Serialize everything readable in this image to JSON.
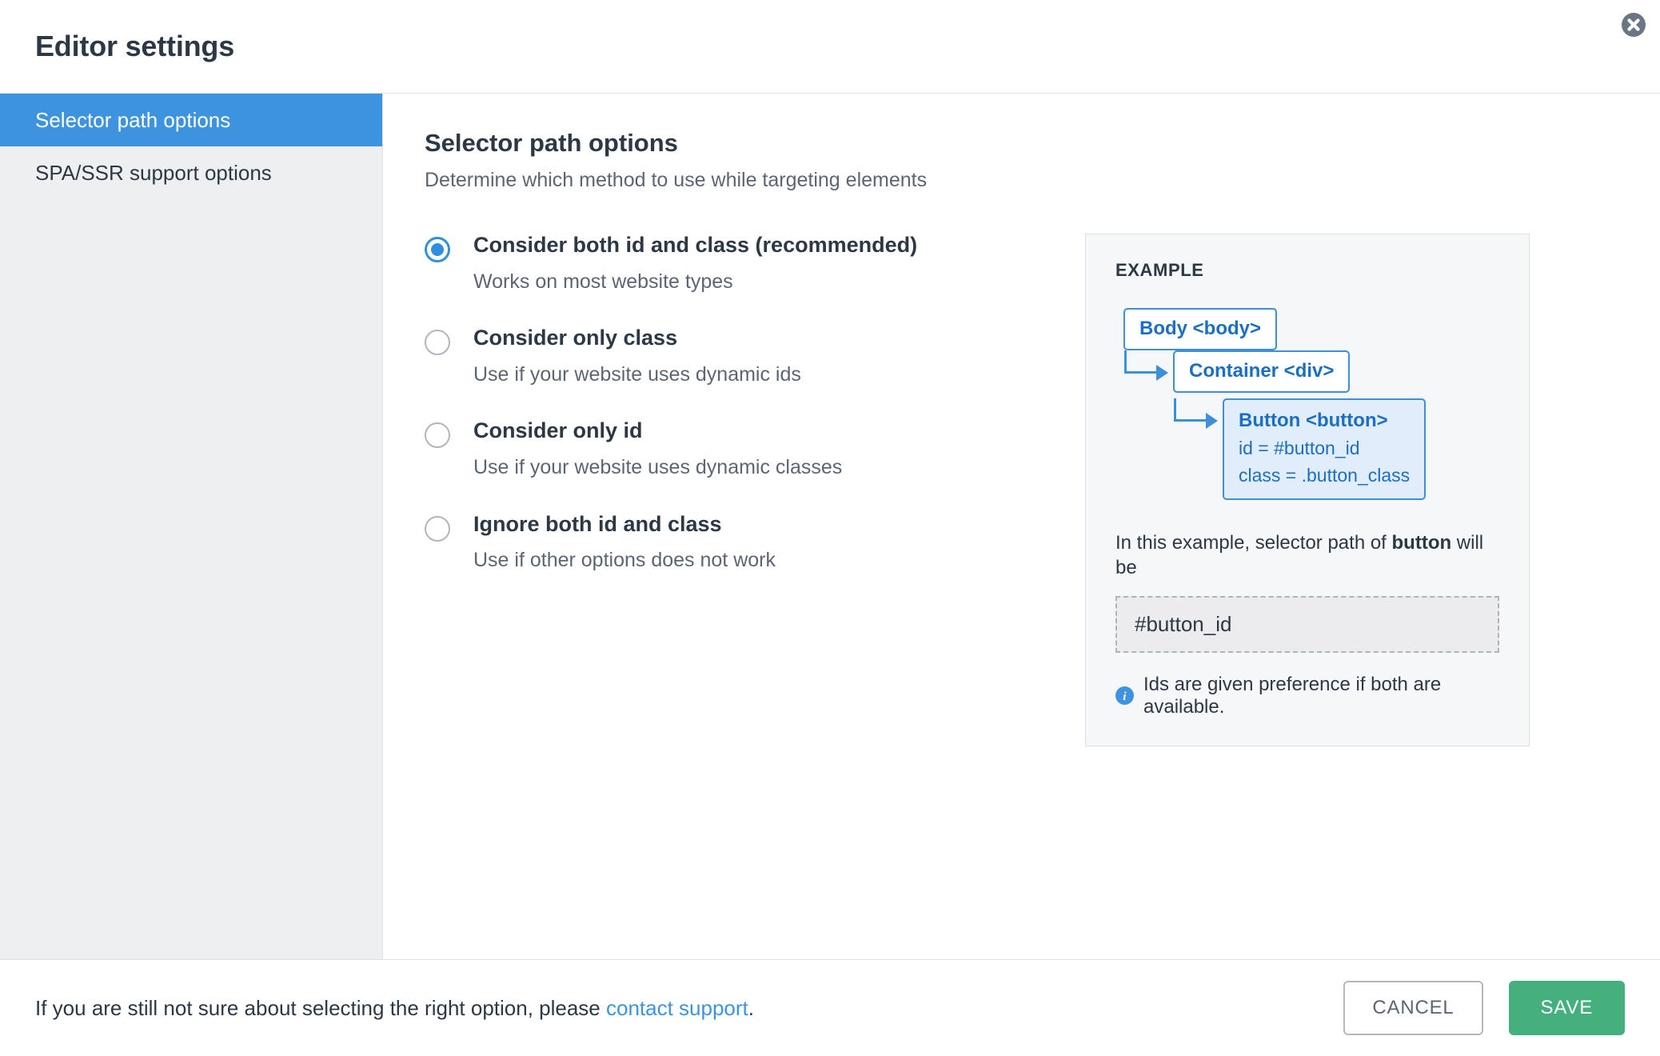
{
  "header": {
    "title": "Editor settings",
    "close_icon": "close-icon"
  },
  "sidebar": {
    "items": [
      {
        "label": "Selector path options",
        "active": true
      },
      {
        "label": "SPA/SSR support options",
        "active": false
      }
    ]
  },
  "main": {
    "section_title": "Selector path options",
    "section_subtitle": "Determine which method to use while targeting elements",
    "options": [
      {
        "label": "Consider both id and class (recommended)",
        "description": "Works on most website types",
        "checked": true
      },
      {
        "label": "Consider only class",
        "description": "Use if your website uses dynamic ids",
        "checked": false
      },
      {
        "label": "Consider only id",
        "description": "Use if your website uses dynamic classes",
        "checked": false
      },
      {
        "label": "Ignore both id and class",
        "description": "Use if other options does not work",
        "checked": false
      }
    ]
  },
  "example": {
    "title": "EXAMPLE",
    "tree": {
      "body_node": "Body <body>",
      "container_node": "Container <div>",
      "button_node": "Button <button>",
      "button_id": "id = #button_id",
      "button_class": "class = .button_class"
    },
    "note_prefix": "In this example, selector path of ",
    "note_bold": "button",
    "note_suffix": " will be",
    "path_value": "#button_id",
    "hint": "Ids are given preference if both are available.",
    "info_icon": "info-icon"
  },
  "footer": {
    "text_prefix": "If you are still not sure about selecting the right option, please ",
    "link_label": "contact support",
    "text_suffix": ".",
    "cancel_label": "CANCEL",
    "save_label": "SAVE"
  },
  "colors": {
    "accent_blue": "#3d93e0",
    "node_blue": "#1a6fc4",
    "save_green": "#45b07d",
    "sidebar_bg": "#eeeff1",
    "panel_bg": "#f6f7f8"
  }
}
